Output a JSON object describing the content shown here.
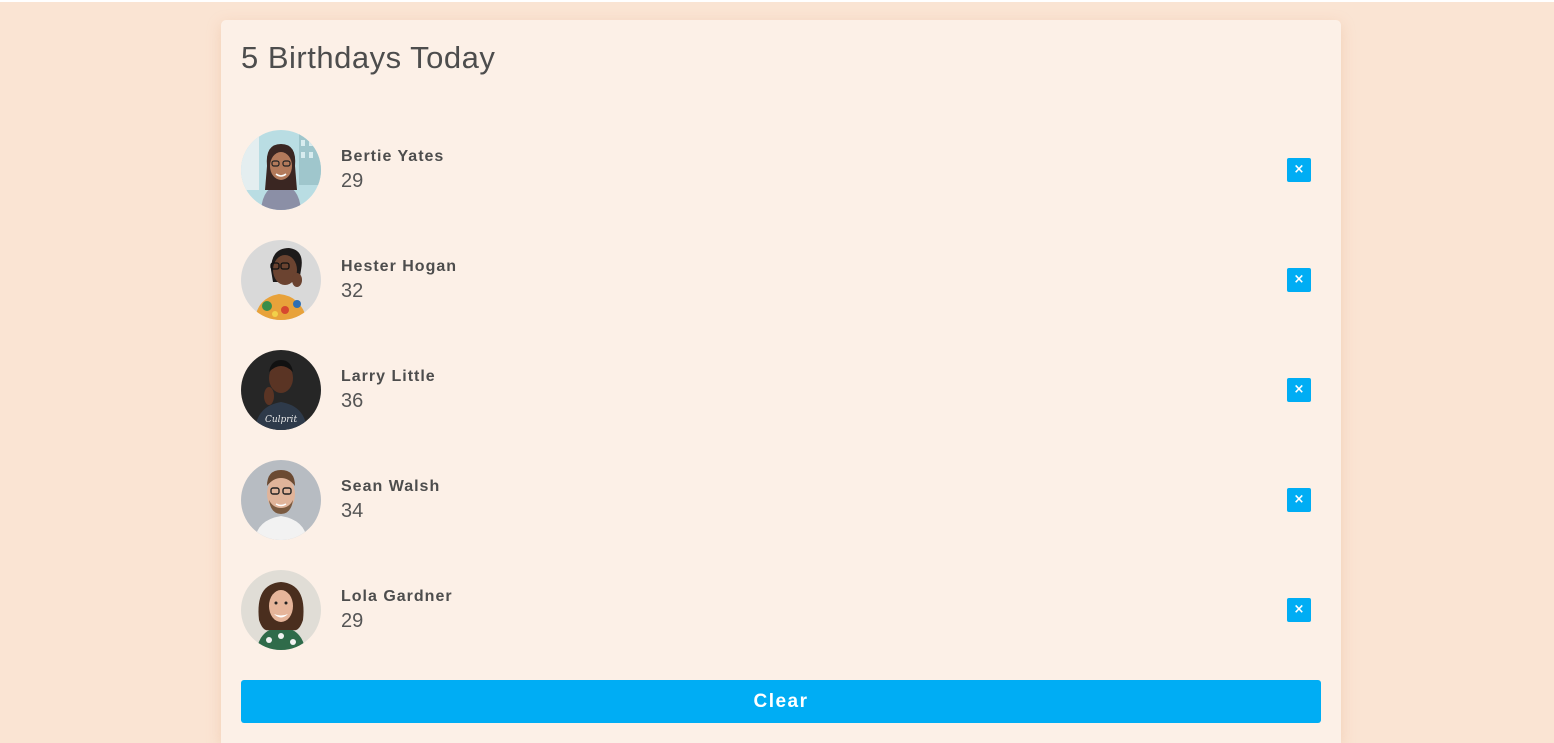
{
  "header": {
    "title": "5 Birthdays Today"
  },
  "people": [
    {
      "name": "Bertie Yates",
      "age": "29",
      "avatar": "woman-glasses-street-photo"
    },
    {
      "name": "Hester Hogan",
      "age": "32",
      "avatar": "woman-glasses-floral-photo"
    },
    {
      "name": "Larry Little",
      "age": "36",
      "avatar": "man-dark-tshirt-photo"
    },
    {
      "name": "Sean Walsh",
      "age": "34",
      "avatar": "man-glasses-beard-photo"
    },
    {
      "name": "Lola Gardner",
      "age": "29",
      "avatar": "woman-curly-hair-photo"
    }
  ],
  "remove_label": "×",
  "clear_label": "Clear",
  "colors": {
    "page_background": "#fae4d3",
    "card_background": "#fcf0e7",
    "accent": "#00adf4",
    "text": "#4d4d4d"
  }
}
